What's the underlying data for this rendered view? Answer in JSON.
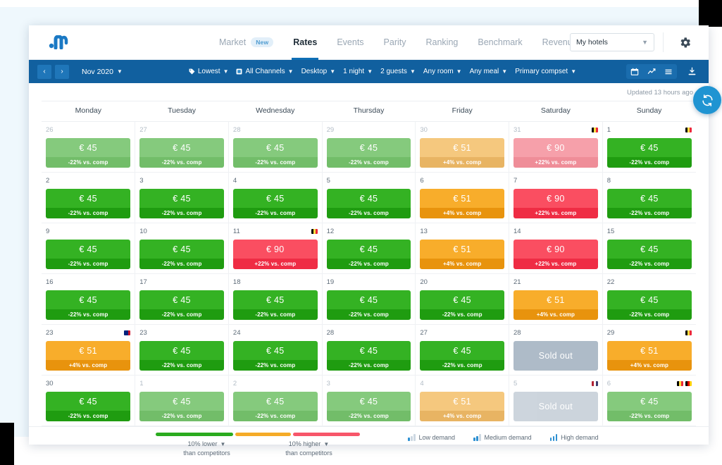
{
  "app": {
    "logo_name": "hotel-analytics-logo"
  },
  "nav": {
    "items": [
      {
        "label": "Market",
        "active": false,
        "badge": "New",
        "lock": false
      },
      {
        "label": "Rates",
        "active": true,
        "badge": "",
        "lock": false
      },
      {
        "label": "Events",
        "active": false,
        "badge": "",
        "lock": false
      },
      {
        "label": "Parity",
        "active": false,
        "badge": "",
        "lock": false
      },
      {
        "label": "Ranking",
        "active": false,
        "badge": "",
        "lock": false
      },
      {
        "label": "Benchmark",
        "active": false,
        "badge": "",
        "lock": false
      },
      {
        "label": "Revenue",
        "active": false,
        "badge": "",
        "lock": true
      }
    ],
    "hotel_select": "My hotels",
    "settings_icon": "gear-icon"
  },
  "toolbar": {
    "prev_label": "‹",
    "next_label": "›",
    "month": "Nov 2020",
    "filters": [
      {
        "label": "Lowest",
        "icon": "tag-icon"
      },
      {
        "label": "All Channels",
        "icon": "channels-icon"
      },
      {
        "label": "Desktop",
        "icon": ""
      },
      {
        "label": "1 night",
        "icon": ""
      },
      {
        "label": "2 guests",
        "icon": ""
      },
      {
        "label": "Any room",
        "icon": ""
      },
      {
        "label": "Any meal",
        "icon": ""
      },
      {
        "label": "Primary compset",
        "icon": ""
      }
    ],
    "view_icons": [
      "calendar-icon",
      "line-chart-icon",
      "list-icon"
    ],
    "export_icon": "download-icon"
  },
  "calendar": {
    "updated_text": "Updated 13 hours ago",
    "refresh_icon": "refresh-icon",
    "weekdays": [
      "Monday",
      "Tuesday",
      "Wednesday",
      "Thursday",
      "Friday",
      "Saturday",
      "Sunday"
    ],
    "rows": [
      [
        {
          "day": "26",
          "dim": true,
          "price": "€ 45",
          "delta": "-22% vs. comp",
          "state": "green",
          "flags": []
        },
        {
          "day": "27",
          "dim": true,
          "price": "€ 45",
          "delta": "-22% vs. comp",
          "state": "green",
          "flags": []
        },
        {
          "day": "28",
          "dim": true,
          "price": "€ 45",
          "delta": "-22% vs. comp",
          "state": "green",
          "flags": []
        },
        {
          "day": "29",
          "dim": true,
          "price": "€ 45",
          "delta": "-22% vs. comp",
          "state": "green",
          "flags": []
        },
        {
          "day": "30",
          "dim": true,
          "price": "€ 51",
          "delta": "+4% vs. comp",
          "state": "orange",
          "flags": []
        },
        {
          "day": "31",
          "dim": true,
          "price": "€ 90",
          "delta": "+22% vs. comp",
          "state": "red",
          "flags": [
            "be"
          ]
        },
        {
          "day": "1",
          "dim": false,
          "price": "€ 45",
          "delta": "-22% vs. comp",
          "state": "green",
          "flags": [
            "be"
          ]
        }
      ],
      [
        {
          "day": "2",
          "dim": false,
          "price": "€ 45",
          "delta": "-22% vs. comp",
          "state": "green",
          "flags": []
        },
        {
          "day": "3",
          "dim": false,
          "price": "€ 45",
          "delta": "-22% vs. comp",
          "state": "green",
          "flags": []
        },
        {
          "day": "4",
          "dim": false,
          "price": "€ 45",
          "delta": "-22% vs. comp",
          "state": "green",
          "flags": []
        },
        {
          "day": "5",
          "dim": false,
          "price": "€ 45",
          "delta": "-22% vs. comp",
          "state": "green",
          "flags": []
        },
        {
          "day": "6",
          "dim": false,
          "price": "€ 51",
          "delta": "+4% vs. comp",
          "state": "orange",
          "flags": []
        },
        {
          "day": "7",
          "dim": false,
          "price": "€ 90",
          "delta": "+22% vs. comp",
          "state": "red",
          "flags": []
        },
        {
          "day": "8",
          "dim": false,
          "price": "€ 45",
          "delta": "-22% vs. comp",
          "state": "green",
          "flags": []
        }
      ],
      [
        {
          "day": "9",
          "dim": false,
          "price": "€ 45",
          "delta": "-22% vs. comp",
          "state": "green",
          "flags": []
        },
        {
          "day": "10",
          "dim": false,
          "price": "€ 45",
          "delta": "-22% vs. comp",
          "state": "green",
          "flags": []
        },
        {
          "day": "11",
          "dim": false,
          "price": "€ 90",
          "delta": "+22% vs. comp",
          "state": "red",
          "flags": [
            "be"
          ]
        },
        {
          "day": "12",
          "dim": false,
          "price": "€ 45",
          "delta": "-22% vs. comp",
          "state": "green",
          "flags": []
        },
        {
          "day": "13",
          "dim": false,
          "price": "€ 51",
          "delta": "+4% vs. comp",
          "state": "orange",
          "flags": []
        },
        {
          "day": "14",
          "dim": false,
          "price": "€ 90",
          "delta": "+22% vs. comp",
          "state": "red",
          "flags": []
        },
        {
          "day": "15",
          "dim": false,
          "price": "€ 45",
          "delta": "-22% vs. comp",
          "state": "green",
          "flags": []
        }
      ],
      [
        {
          "day": "16",
          "dim": false,
          "price": "€ 45",
          "delta": "-22% vs. comp",
          "state": "green",
          "flags": []
        },
        {
          "day": "17",
          "dim": false,
          "price": "€ 45",
          "delta": "-22% vs. comp",
          "state": "green",
          "flags": []
        },
        {
          "day": "18",
          "dim": false,
          "price": "€ 45",
          "delta": "-22% vs. comp",
          "state": "green",
          "flags": []
        },
        {
          "day": "19",
          "dim": false,
          "price": "€ 45",
          "delta": "-22% vs. comp",
          "state": "green",
          "flags": []
        },
        {
          "day": "20",
          "dim": false,
          "price": "€ 45",
          "delta": "-22% vs. comp",
          "state": "green",
          "flags": []
        },
        {
          "day": "21",
          "dim": false,
          "price": "€ 51",
          "delta": "+4% vs. comp",
          "state": "orange",
          "flags": []
        },
        {
          "day": "22",
          "dim": false,
          "price": "€ 45",
          "delta": "-22% vs. comp",
          "state": "green",
          "flags": []
        }
      ],
      [
        {
          "day": "23",
          "dim": false,
          "price": "€ 51",
          "delta": "+4% vs. comp",
          "state": "orange",
          "flags": [
            "au"
          ]
        },
        {
          "day": "23",
          "dim": false,
          "price": "€ 45",
          "delta": "-22% vs. comp",
          "state": "green",
          "flags": []
        },
        {
          "day": "24",
          "dim": false,
          "price": "€ 45",
          "delta": "-22% vs. comp",
          "state": "green",
          "flags": []
        },
        {
          "day": "28",
          "dim": false,
          "price": "€ 45",
          "delta": "-22% vs. comp",
          "state": "green",
          "flags": []
        },
        {
          "day": "27",
          "dim": false,
          "price": "€ 45",
          "delta": "-22% vs. comp",
          "state": "green",
          "flags": []
        },
        {
          "day": "28",
          "dim": false,
          "price": "Sold out",
          "delta": "",
          "state": "soldout",
          "flags": []
        },
        {
          "day": "29",
          "dim": false,
          "price": "€ 51",
          "delta": "+4% vs. comp",
          "state": "orange",
          "flags": [
            "be"
          ]
        }
      ],
      [
        {
          "day": "30",
          "dim": false,
          "price": "€ 45",
          "delta": "-22% vs. comp",
          "state": "green",
          "flags": []
        },
        {
          "day": "1",
          "dim": true,
          "price": "€ 45",
          "delta": "-22% vs. comp",
          "state": "green",
          "flags": []
        },
        {
          "day": "2",
          "dim": true,
          "price": "€ 45",
          "delta": "-22% vs. comp",
          "state": "green",
          "flags": []
        },
        {
          "day": "3",
          "dim": true,
          "price": "€ 45",
          "delta": "-22% vs. comp",
          "state": "green",
          "flags": []
        },
        {
          "day": "4",
          "dim": true,
          "price": "€ 51",
          "delta": "+4% vs. comp",
          "state": "orange",
          "flags": []
        },
        {
          "day": "5",
          "dim": true,
          "price": "Sold out",
          "delta": "",
          "state": "soldout",
          "flags": [
            "us"
          ]
        },
        {
          "day": "6",
          "dim": true,
          "price": "€ 45",
          "delta": "-22% vs. comp",
          "state": "green",
          "flags": [
            "be",
            "de"
          ]
        }
      ]
    ]
  },
  "legend": {
    "scale": [
      {
        "value": "10% lower",
        "sub": "than competitors"
      },
      {
        "value": "10% higher",
        "sub": "than competitors"
      }
    ],
    "demand": [
      {
        "label": "Low demand",
        "level": 1
      },
      {
        "label": "Medium demand",
        "level": 2
      },
      {
        "label": "High demand",
        "level": 3
      }
    ]
  },
  "colors": {
    "brand_blue": "#11609f",
    "accent_blue": "#1f94d2",
    "green": "#2bab1f",
    "orange": "#f5ab28",
    "red": "#f7566a",
    "soldout": "#aebbc8"
  }
}
